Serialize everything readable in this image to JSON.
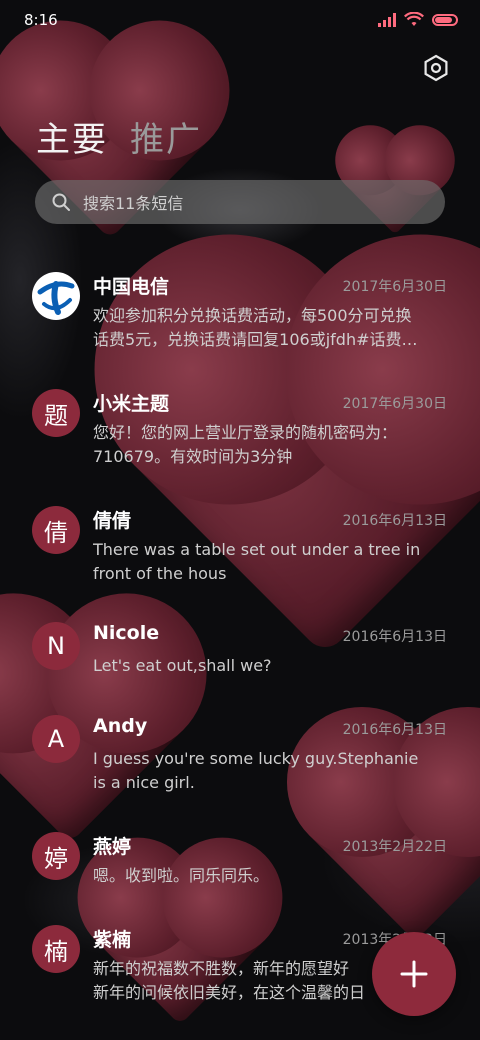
{
  "status": {
    "time": "8:16"
  },
  "tabs": [
    {
      "label": "主要"
    },
    {
      "label": "推广"
    }
  ],
  "search": {
    "placeholder": "搜索11条短信"
  },
  "messages": [
    {
      "avatar": "",
      "name": "中国电信",
      "date": "2017年6月30日",
      "lines": [
        "欢迎参加积分兑换话费活动，每500分可兑换",
        "话费5元，兑换话费请回复106或jfdh#话费…"
      ]
    },
    {
      "avatar": "题",
      "name": "小米主题",
      "date": "2017年6月30日",
      "lines": [
        "您好！您的网上营业厅登录的随机密码为：",
        "710679。有效时间为3分钟"
      ]
    },
    {
      "avatar": "倩",
      "name": "倩倩",
      "date": "2016年6月13日",
      "lines": [
        "There was a table set out under a tree in",
        "front of the hous"
      ]
    },
    {
      "avatar": "N",
      "name": "Nicole",
      "date": "2016年6月13日",
      "lines": [
        "Let's eat out,shall we?"
      ]
    },
    {
      "avatar": "A",
      "name": "Andy",
      "date": "2016年6月13日",
      "lines": [
        "I guess you're some lucky guy.Stephanie",
        "is a nice girl."
      ]
    },
    {
      "avatar": "婷",
      "name": "燕婷",
      "date": "2013年2月22日",
      "lines": [
        "嗯。收到啦。同乐同乐。"
      ]
    },
    {
      "avatar": "楠",
      "name": "紫楠",
      "date": "2013年2月22日",
      "lines": [
        "新年的祝福数不胜数，新年的愿望好",
        "新年的问候依旧美好，在这个温馨的日"
      ]
    }
  ],
  "colors": {
    "accent": "#8e2a3c",
    "status_icons": "#ff6b7f"
  },
  "icons": {
    "settings": "hexagon-gear-icon",
    "search": "search-icon",
    "compose": "plus-icon",
    "telecom_logo": "china-telecom-logo"
  }
}
